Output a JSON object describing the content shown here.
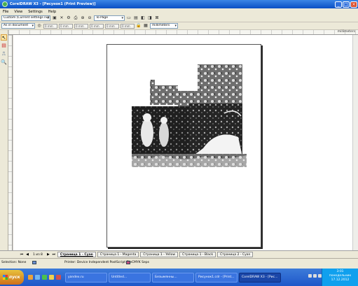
{
  "window": {
    "title": "CorelDRAW X3 - [Рисунок1 (Print Preview)]",
    "controls": [
      "_",
      "□",
      "×"
    ]
  },
  "menu": [
    "File",
    "View",
    "Settings",
    "Help"
  ],
  "toolbar1": {
    "print_style": "Custom (Current settings not s...",
    "fit_mode": "To Page"
  },
  "toolbar2": {
    "position_select": "As in document",
    "unit_select": "millimeters",
    "fields": [
      "0 mm",
      "0 mm",
      "0 mm",
      "0 mm",
      "0 mm",
      "0 mm"
    ]
  },
  "ruler": {
    "unit": "millimeters"
  },
  "toolbox": {
    "tools": [
      "pick-tool-icon",
      "imposition-tool-icon",
      "marks-tool-icon",
      "zoom-tool-icon"
    ]
  },
  "pagebar": {
    "counter": "1 из 8",
    "tabs": [
      "Страница 1 - Cyan",
      "Страница 1 - Magenta",
      "Страница 1 - Yellow",
      "Страница 1 - Black",
      "Страница 2 - Cyan"
    ]
  },
  "status": {
    "selection": "Selection: None",
    "printer": "Printer: Device Independent PostScript File",
    "color": "CMYK Seps"
  },
  "taskbar": {
    "start": "пуск",
    "tasks": [
      "yandex.ru",
      "Untitled...",
      "Безымянны...",
      "Рисунок1.cdr - [Print...",
      "CorelDRAW X3 - [Рис..."
    ],
    "clock": {
      "time": "3:01",
      "day": "понедельник",
      "date": "17.12.2012"
    }
  },
  "colors": {
    "title_blue": "#0a4fc4",
    "taskbar_blue": "#1d57c9",
    "start_orange": "#cf6f1a"
  }
}
